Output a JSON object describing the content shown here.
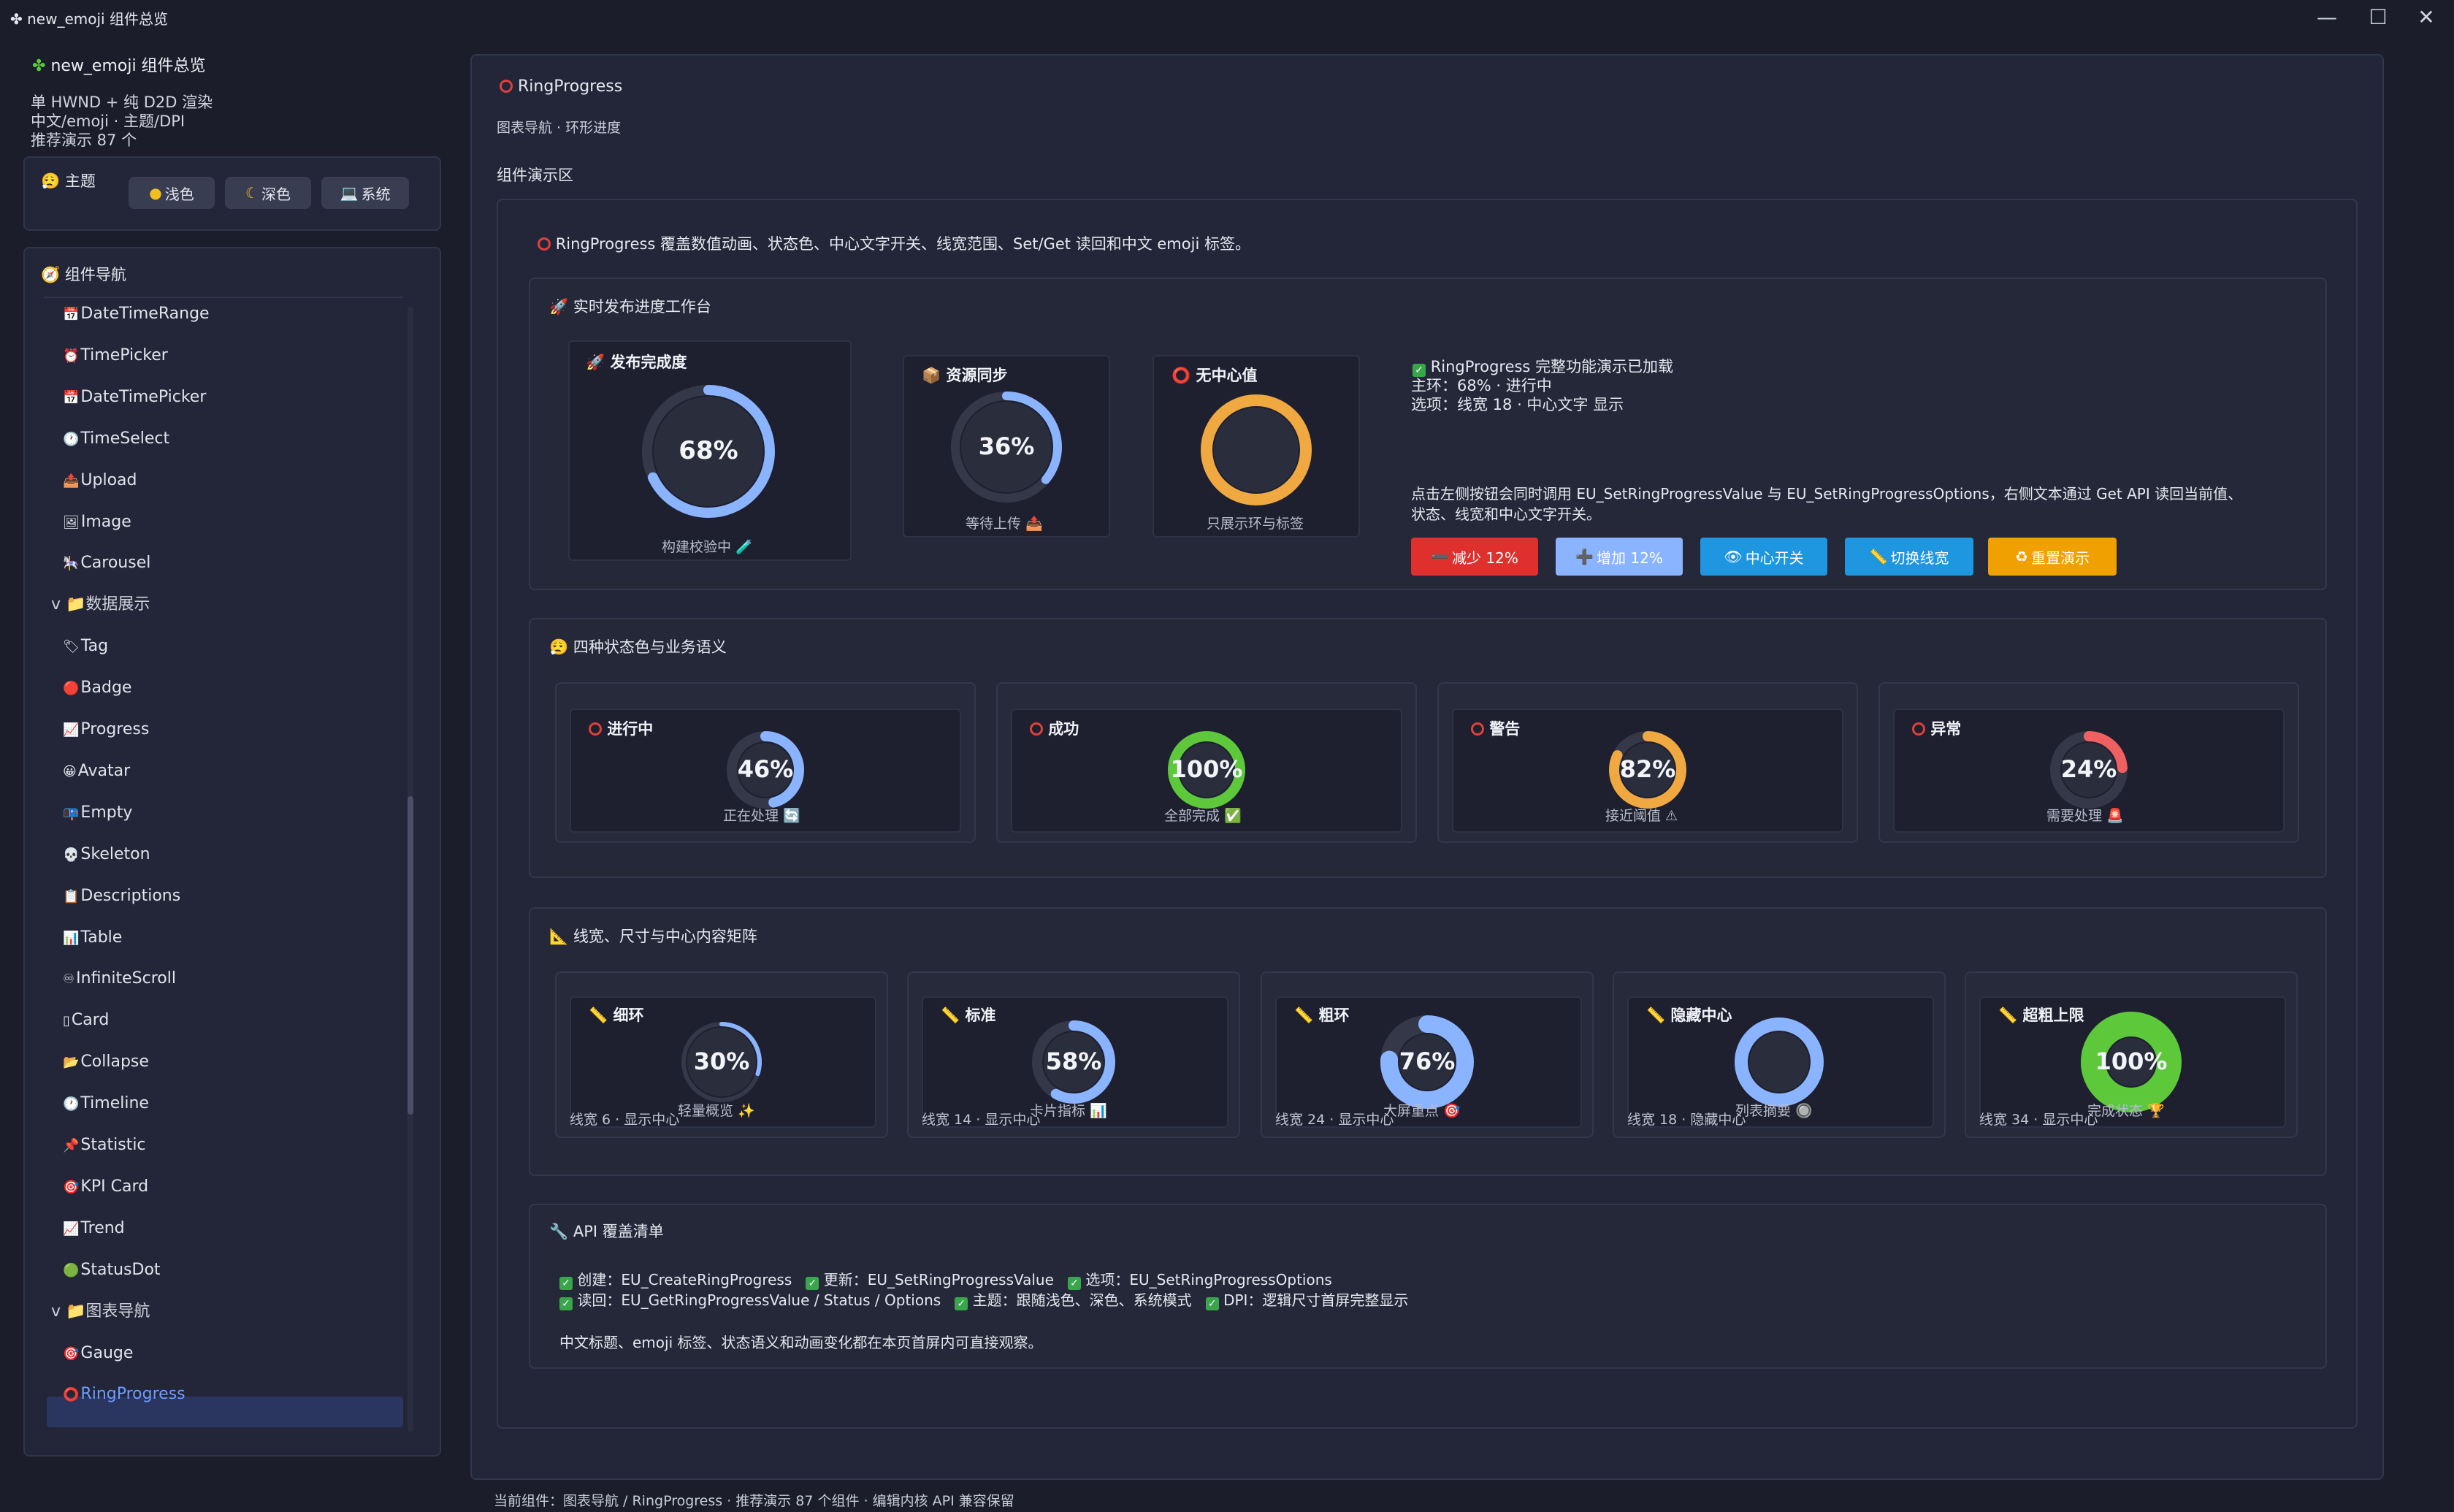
{
  "window": {
    "title": "new_emoji 组件总览",
    "minimize": "—",
    "maximize": "☐",
    "close": "✕"
  },
  "sidebar": {
    "app_title": "new_emoji 组件总览",
    "subtitle_lines": [
      "单 HWND + 纯 D2D 渲染",
      "中文/emoji · 主题/DPI",
      "推荐演示 87 个"
    ],
    "theme_title": "主题",
    "theme_buttons": [
      "浅色",
      "深色",
      "系统"
    ],
    "nav_title": "组件导航",
    "nav_items": [
      {
        "icon": "📅",
        "label": "DateTimeRange"
      },
      {
        "icon": "⏰",
        "label": "TimePicker"
      },
      {
        "icon": "📅",
        "label": "DateTimePicker"
      },
      {
        "icon": "🕐",
        "label": "TimeSelect"
      },
      {
        "icon": "📤",
        "label": "Upload"
      },
      {
        "icon": "🖼",
        "label": "Image"
      },
      {
        "icon": "🎠",
        "label": "Carousel"
      },
      {
        "group": true,
        "label": "v 📁数据展示"
      },
      {
        "icon": "🏷",
        "label": "Tag"
      },
      {
        "icon": "🔴",
        "label": "Badge"
      },
      {
        "icon": "📈",
        "label": "Progress"
      },
      {
        "icon": "😀",
        "label": "Avatar"
      },
      {
        "icon": "📭",
        "label": "Empty"
      },
      {
        "icon": "💀",
        "label": "Skeleton"
      },
      {
        "icon": "📋",
        "label": "Descriptions"
      },
      {
        "icon": "📊",
        "label": "Table"
      },
      {
        "icon": "♾",
        "label": "InfiniteScroll"
      },
      {
        "icon": "▯",
        "label": "Card"
      },
      {
        "icon": "📂",
        "label": "Collapse"
      },
      {
        "icon": "🕐",
        "label": "Timeline"
      },
      {
        "icon": "📌",
        "label": "Statistic"
      },
      {
        "icon": "🎯",
        "label": "KPI Card"
      },
      {
        "icon": "📈",
        "label": "Trend"
      },
      {
        "icon": "🟢",
        "label": "StatusDot"
      },
      {
        "group": true,
        "label": "v 📁图表导航"
      },
      {
        "icon": "🎯",
        "label": "Gauge"
      },
      {
        "icon": "⭕",
        "label": "RingProgress",
        "selected": true
      }
    ]
  },
  "main": {
    "title": "RingProgress",
    "breadcrumb": "图表导航 · 环形进度",
    "demo_area_label": "组件演示区",
    "intro": "RingProgress 覆盖数值动画、状态色、中心文字开关、线宽范围、Set/Get 读回和中文 emoji 标签。",
    "workbench": {
      "title": "实时发布进度工作台",
      "cards": [
        {
          "title": "发布完成度",
          "icon": "🚀",
          "value": 68,
          "text": "68%",
          "caption": "构建校验中 🧪",
          "color": "#8ab4ff"
        },
        {
          "title": "资源同步",
          "icon": "📦",
          "value": 36,
          "text": "36%",
          "caption": "等待上传 📤",
          "color": "#8ab4ff"
        },
        {
          "title": "无中心值",
          "icon": "⭕",
          "value": 100,
          "text": "",
          "caption": "只展示环与标签",
          "color": "#f0a840"
        }
      ],
      "status_line": "RingProgress 完整功能演示已加载",
      "main_ring_line": "主环：68% · 进行中",
      "options_line": "选项：线宽 18 · 中心文字 显示",
      "hint": "点击左侧按钮会同时调用 EU_SetRingProgressValue 与 EU_SetRingProgressOptions，右侧文本通过 Get API 读回当前值、状态、线宽和中心文字开关。",
      "buttons": [
        {
          "label": "减少 12%",
          "icon": "➖",
          "bg": "#e0302e"
        },
        {
          "label": "增加 12%",
          "icon": "➕",
          "bg": "#8ab4ff"
        },
        {
          "label": "中心开关",
          "icon": "👁",
          "bg": "#1e96e0"
        },
        {
          "label": "切换线宽",
          "icon": "📏",
          "bg": "#1e96e0"
        },
        {
          "label": "重置演示",
          "icon": "♻",
          "bg": "#f0a000"
        }
      ]
    },
    "states": {
      "title": "四种状态色与业务语义",
      "cards": [
        {
          "title": "进行中",
          "value": 46,
          "text": "46%",
          "caption": "正在处理 🔄",
          "color": "#8ab4ff"
        },
        {
          "title": "成功",
          "value": 100,
          "text": "100%",
          "caption": "全部完成 ✅",
          "color": "#5cc83a"
        },
        {
          "title": "警告",
          "value": 82,
          "text": "82%",
          "caption": "接近阈值 ⚠",
          "color": "#f0a840"
        },
        {
          "title": "异常",
          "value": 24,
          "text": "24%",
          "caption": "需要处理 🚨",
          "color": "#f06060"
        }
      ]
    },
    "matrix": {
      "title": "线宽、尺寸与中心内容矩阵",
      "cards": [
        {
          "title": "细环",
          "value": 30,
          "text": "30%",
          "caption": "轻量概览 ✨",
          "footer": "线宽 6 · 显示中心",
          "color": "#8ab4ff"
        },
        {
          "title": "标准",
          "value": 58,
          "text": "58%",
          "caption": "卡片指标 📊",
          "footer": "线宽 14 · 显示中心",
          "color": "#8ab4ff"
        },
        {
          "title": "粗环",
          "value": 76,
          "text": "76%",
          "caption": "大屏重点 🎯",
          "footer": "线宽 24 · 显示中心",
          "color": "#8ab4ff"
        },
        {
          "title": "隐藏中心",
          "value": 100,
          "text": "",
          "caption": "列表摘要 🔘",
          "footer": "线宽 18 · 隐藏中心",
          "color": "#8ab4ff"
        },
        {
          "title": "超粗上限",
          "value": 100,
          "text": "100%",
          "caption": "完成状态 🏆",
          "footer": "线宽 34 · 显示中心",
          "color": "#5cc83a"
        }
      ]
    },
    "api": {
      "title": "API 覆盖清单",
      "row1": [
        "创建：EU_CreateRingProgress",
        "更新：EU_SetRingProgressValue",
        "选项：EU_SetRingProgressOptions"
      ],
      "row2": [
        "读回：EU_GetRingProgressValue / Status / Options",
        "主题：跟随浅色、深色、系统模式",
        "DPI：逻辑尺寸首屏完整显示"
      ],
      "note": "中文标题、emoji 标签、状态语义和动画变化都在本页首屏内可直接观察。"
    },
    "footer": "当前组件：图表导航 / RingProgress · 推荐演示 87 个组件 · 编辑内核 API 兼容保留"
  }
}
